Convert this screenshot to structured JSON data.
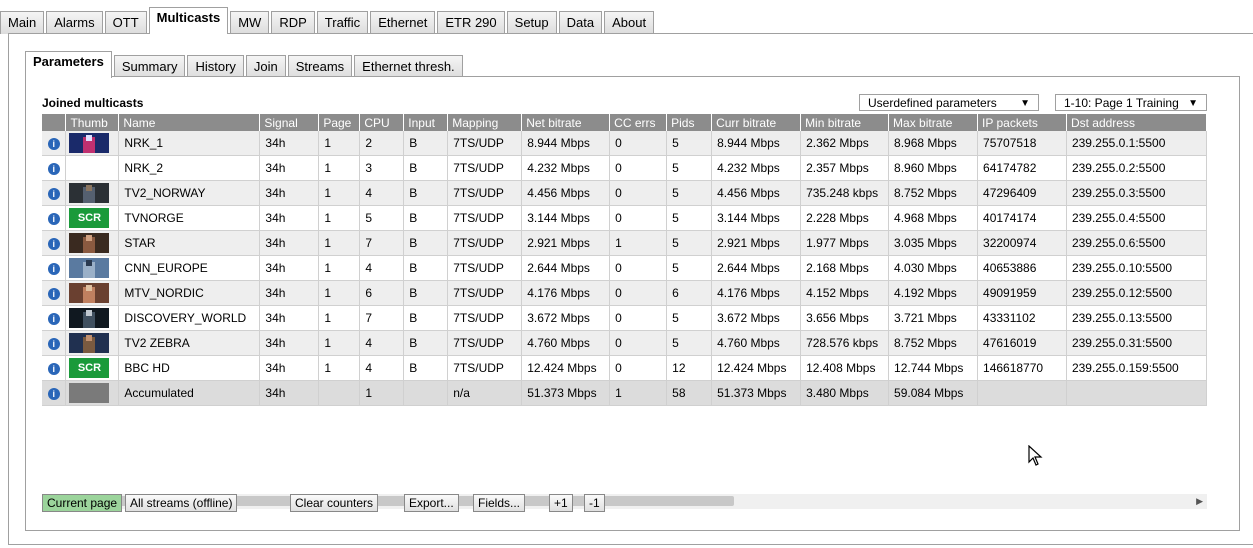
{
  "main_tabs": [
    "Main",
    "Alarms",
    "OTT",
    "Multicasts",
    "MW",
    "RDP",
    "Traffic",
    "Ethernet",
    "ETR 290",
    "Setup",
    "Data",
    "About"
  ],
  "active_main_tab": "Multicasts",
  "sub_tabs": [
    "Parameters",
    "Summary",
    "History",
    "Join",
    "Streams",
    "Ethernet thresh."
  ],
  "active_sub_tab": "Parameters",
  "section_title": "Joined multicasts",
  "param_select": "Userdefined parameters",
  "page_select": "1-10: Page 1 Training",
  "columns": [
    "",
    "Thumb",
    "Name",
    "Signal",
    "Page",
    "CPU",
    "Input",
    "Mapping",
    "Net bitrate",
    "CC errs",
    "Pids",
    "Curr bitrate",
    "Min bitrate",
    "Max bitrate",
    "IP packets",
    "Dst address"
  ],
  "rows": [
    {
      "thumb": "tv-studio",
      "name": "NRK_1",
      "signal": "34h",
      "page": "1",
      "cpu": "2",
      "input": "B",
      "mapping": "7TS/UDP",
      "net": "8.944 Mbps",
      "cc": "0",
      "pids": "5",
      "curr": "8.944 Mbps",
      "min": "2.362 Mbps",
      "max": "8.968 Mbps",
      "ip": "75707518",
      "dst": "239.255.0.1:5500"
    },
    {
      "thumb": "blank",
      "name": "NRK_2",
      "signal": "34h",
      "page": "1",
      "cpu": "3",
      "input": "B",
      "mapping": "7TS/UDP",
      "net": "4.232 Mbps",
      "cc": "0",
      "pids": "5",
      "curr": "4.232 Mbps",
      "min": "2.357 Mbps",
      "max": "8.960 Mbps",
      "ip": "64174782",
      "dst": "239.255.0.2:5500"
    },
    {
      "thumb": "dark-scene",
      "name": "TV2_NORWAY",
      "signal": "34h",
      "page": "1",
      "cpu": "4",
      "input": "B",
      "mapping": "7TS/UDP",
      "net": "4.456 Mbps",
      "cc": "0",
      "pids": "5",
      "curr": "4.456 Mbps",
      "min": "735.248 kbps",
      "max": "8.752 Mbps",
      "ip": "47296409",
      "dst": "239.255.0.3:5500"
    },
    {
      "thumb": "scr",
      "name": "TVNORGE",
      "signal": "34h",
      "page": "1",
      "cpu": "5",
      "input": "B",
      "mapping": "7TS/UDP",
      "net": "3.144 Mbps",
      "cc": "0",
      "pids": "5",
      "curr": "3.144 Mbps",
      "min": "2.228 Mbps",
      "max": "4.968 Mbps",
      "ip": "40174174",
      "dst": "239.255.0.4:5500"
    },
    {
      "thumb": "person",
      "name": "STAR",
      "signal": "34h",
      "page": "1",
      "cpu": "7",
      "input": "B",
      "mapping": "7TS/UDP",
      "net": "2.921 Mbps",
      "cc": "1",
      "pids": "5",
      "curr": "2.921 Mbps",
      "min": "1.977 Mbps",
      "max": "3.035 Mbps",
      "ip": "32200974",
      "dst": "239.255.0.6:5500"
    },
    {
      "thumb": "sky",
      "name": "CNN_EUROPE",
      "signal": "34h",
      "page": "1",
      "cpu": "4",
      "input": "B",
      "mapping": "7TS/UDP",
      "net": "2.644 Mbps",
      "cc": "0",
      "pids": "5",
      "curr": "2.644 Mbps",
      "min": "2.168 Mbps",
      "max": "4.030 Mbps",
      "ip": "40653886",
      "dst": "239.255.0.10:5500"
    },
    {
      "thumb": "warm",
      "name": "MTV_NORDIC",
      "signal": "34h",
      "page": "1",
      "cpu": "6",
      "input": "B",
      "mapping": "7TS/UDP",
      "net": "4.176 Mbps",
      "cc": "0",
      "pids": "6",
      "curr": "4.176 Mbps",
      "min": "4.152 Mbps",
      "max": "4.192 Mbps",
      "ip": "49091959",
      "dst": "239.255.0.12:5500"
    },
    {
      "thumb": "space",
      "name": "DISCOVERY_WORLD",
      "signal": "34h",
      "page": "1",
      "cpu": "7",
      "input": "B",
      "mapping": "7TS/UDP",
      "net": "3.672 Mbps",
      "cc": "0",
      "pids": "5",
      "curr": "3.672 Mbps",
      "min": "3.656 Mbps",
      "max": "3.721 Mbps",
      "ip": "43331102",
      "dst": "239.255.0.13:5500"
    },
    {
      "thumb": "anchor",
      "name": "TV2 ZEBRA",
      "signal": "34h",
      "page": "1",
      "cpu": "4",
      "input": "B",
      "mapping": "7TS/UDP",
      "net": "4.760 Mbps",
      "cc": "0",
      "pids": "5",
      "curr": "4.760 Mbps",
      "min": "728.576 kbps",
      "max": "8.752 Mbps",
      "ip": "47616019",
      "dst": "239.255.0.31:5500"
    },
    {
      "thumb": "scr",
      "name": "BBC HD",
      "signal": "34h",
      "page": "1",
      "cpu": "4",
      "input": "B",
      "mapping": "7TS/UDP",
      "net": "12.424 Mbps",
      "cc": "0",
      "pids": "12",
      "curr": "12.424 Mbps",
      "min": "12.408 Mbps",
      "max": "12.744 Mbps",
      "ip": "146618770",
      "dst": "239.255.0.159:5500"
    },
    {
      "thumb": "gray",
      "name": "Accumulated",
      "signal": "34h",
      "page": "",
      "cpu": "1",
      "input": "",
      "mapping": "n/a",
      "net": "51.373 Mbps",
      "cc": "1",
      "pids": "58",
      "curr": "51.373 Mbps",
      "min": "3.480 Mbps",
      "max": "59.084 Mbps",
      "ip": "",
      "dst": ""
    }
  ],
  "scr_label": "SCR",
  "info_glyph": "i",
  "buttons": {
    "current_page": "Current page",
    "all_streams": "All streams (offline)",
    "clear": "Clear counters",
    "export": "Export...",
    "fields": "Fields...",
    "plus": "+1",
    "minus": "-1"
  },
  "scroll_left": "◀",
  "scroll_right": "▶"
}
